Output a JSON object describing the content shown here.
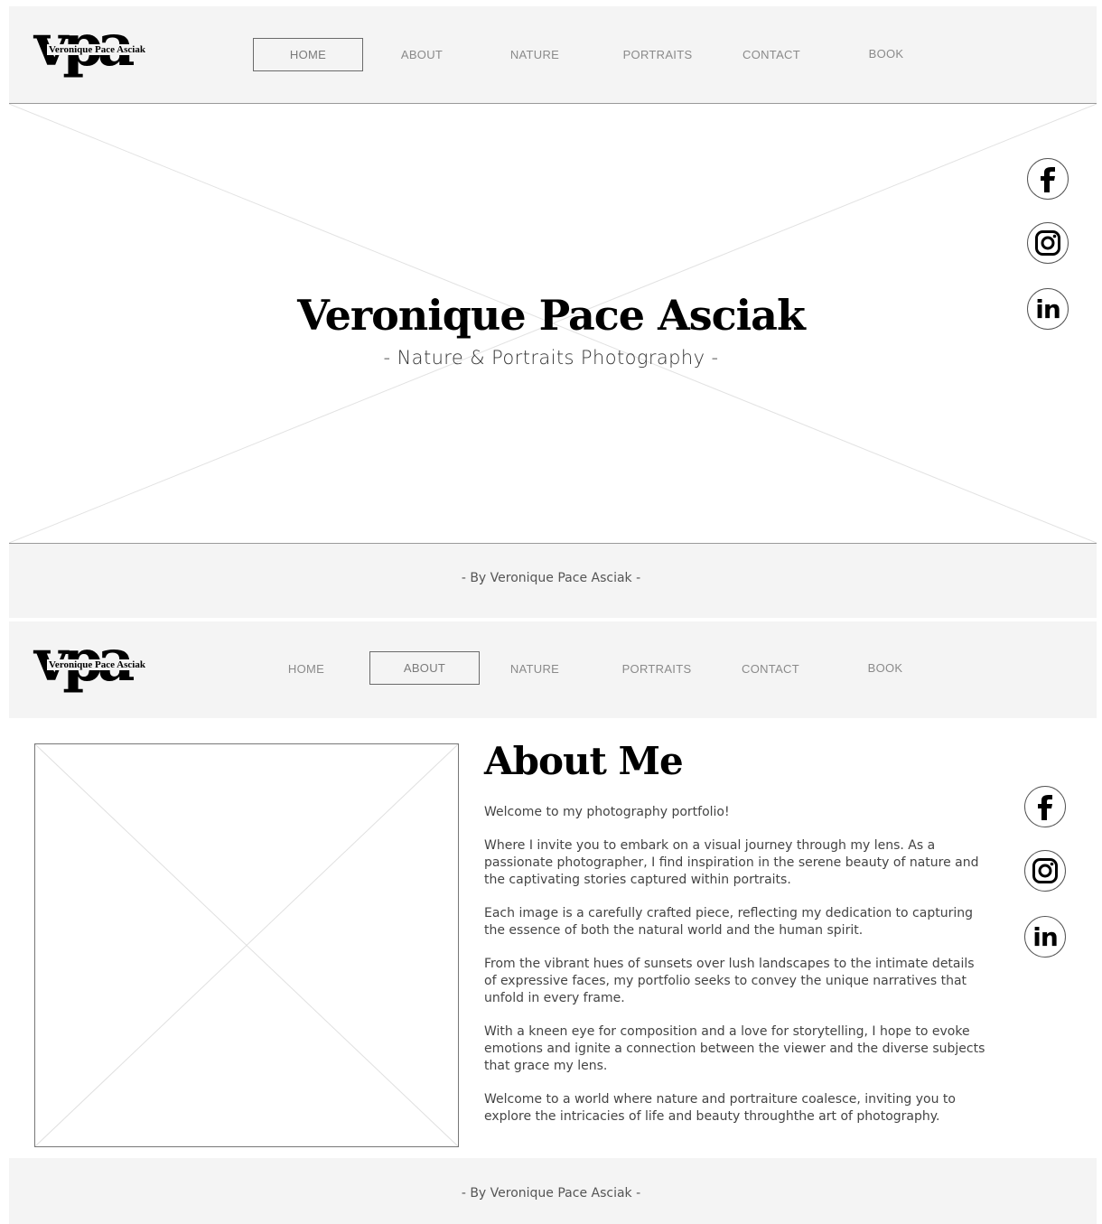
{
  "logo": {
    "letters": "vpa",
    "name": "Veronique Pace Asciak"
  },
  "nav": {
    "items": [
      {
        "label": "HOME"
      },
      {
        "label": "ABOUT"
      },
      {
        "label": "NATURE"
      },
      {
        "label": "PORTRAITS"
      },
      {
        "label": "CONTACT"
      },
      {
        "label": "BOOK"
      }
    ]
  },
  "hero": {
    "title": "Veronique Pace Asciak",
    "subtitle": "- Nature & Portraits Photography -"
  },
  "social": {
    "facebook_icon": "facebook-icon",
    "instagram_icon": "instagram-icon",
    "linkedin_icon": "linkedin-icon",
    "linkedin_text": "in"
  },
  "footer": {
    "text": "-  By Veronique Pace Asciak -"
  },
  "about": {
    "title": "About Me",
    "paragraphs": [
      "Welcome to my photography portfolio!",
      "Where I invite you to embark on a visual journey through my lens. As a passionate photographer, I find inspiration in the serene beauty of nature and the captivating stories captured within portraits.",
      "Each image is a carefully crafted piece, reflecting my dedication to capturing the essence of both the natural world and the human spirit.",
      "From the vibrant hues of sunsets over lush landscapes to the intimate details of expressive faces, my portfolio seeks to convey the unique narratives that unfold in every frame.",
      "With a kneen eye for composition and a love for storytelling, I hope to evoke emotions and ignite a connection between the viewer and the diverse subjects that grace my lens.",
      "Welcome to a world where nature and portraiture coalesce, inviting you to explore the intricacies of life and beauty throughthe art of photography."
    ]
  }
}
